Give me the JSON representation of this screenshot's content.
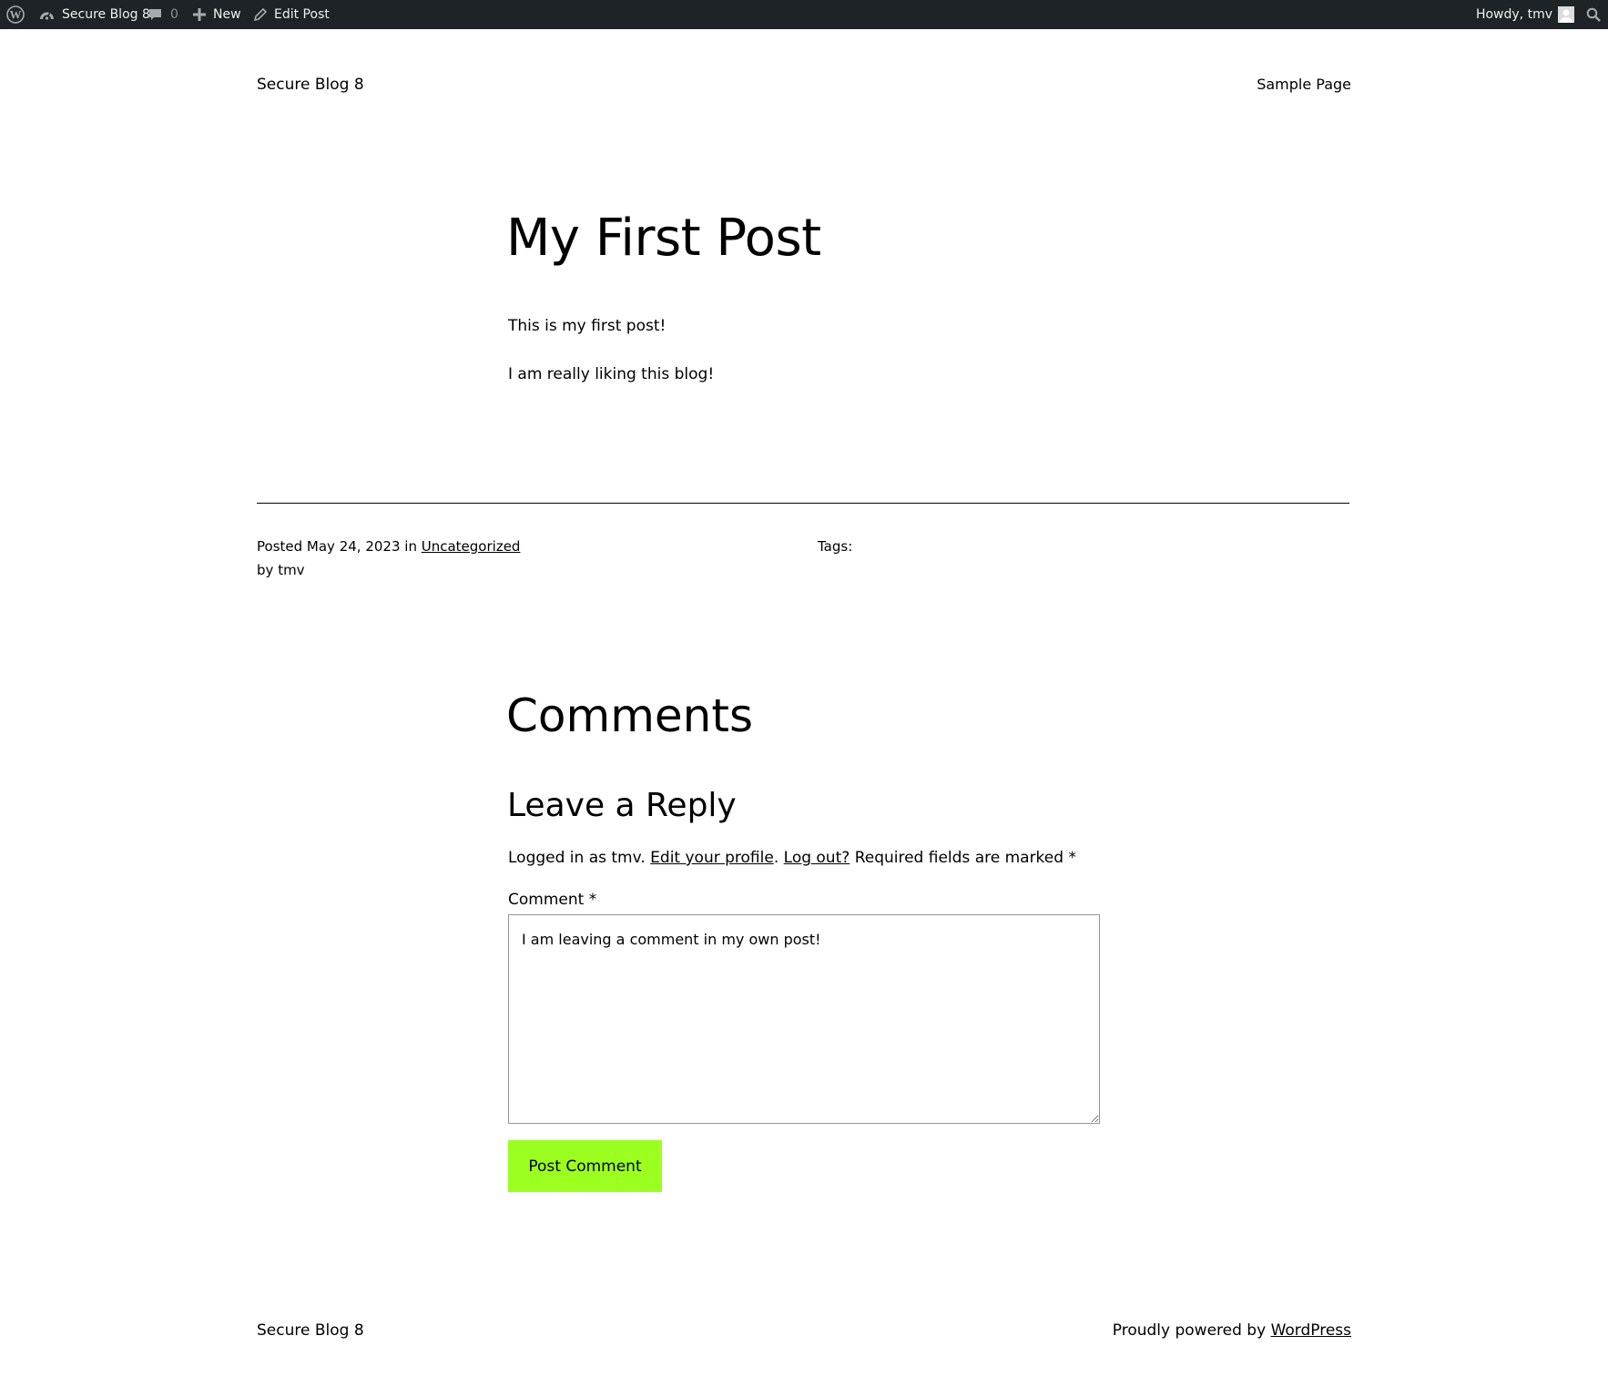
{
  "admin_bar": {
    "wp_logo_icon": "wordpress-logo-icon",
    "site_name": "Secure Blog 8",
    "comments_count": "0",
    "new_label": "New",
    "edit_post_label": "Edit Post",
    "howdy_label": "Howdy, tmv",
    "background_color": "#1d2327"
  },
  "header": {
    "site_title": "Secure Blog 8",
    "nav_items": [
      "Sample Page"
    ]
  },
  "post": {
    "title": "My First Post",
    "paragraphs": [
      "This is my first post!",
      "I am really liking this blog!"
    ],
    "meta": {
      "posted_prefix": "Posted",
      "date": "May 24, 2023",
      "in_label": "in",
      "category": "Uncategorized",
      "by_label": "by",
      "author": "tmv",
      "tags_label": "Tags:"
    }
  },
  "comments": {
    "title": "Comments",
    "reply_title": "Leave a Reply",
    "logged_in_prefix": "Logged in as tmv.",
    "edit_profile_link": "Edit your profile",
    "period": ".",
    "logout_link": "Log out?",
    "required_note": "Required fields are marked *",
    "comment_label": "Comment *",
    "comment_value": "I am leaving a comment in my own post!",
    "submit_label": "Post Comment",
    "submit_color": "#9bff20"
  },
  "footer": {
    "site_title": "Secure Blog 8",
    "powered_prefix": "Proudly powered by",
    "powered_link": "WordPress"
  }
}
